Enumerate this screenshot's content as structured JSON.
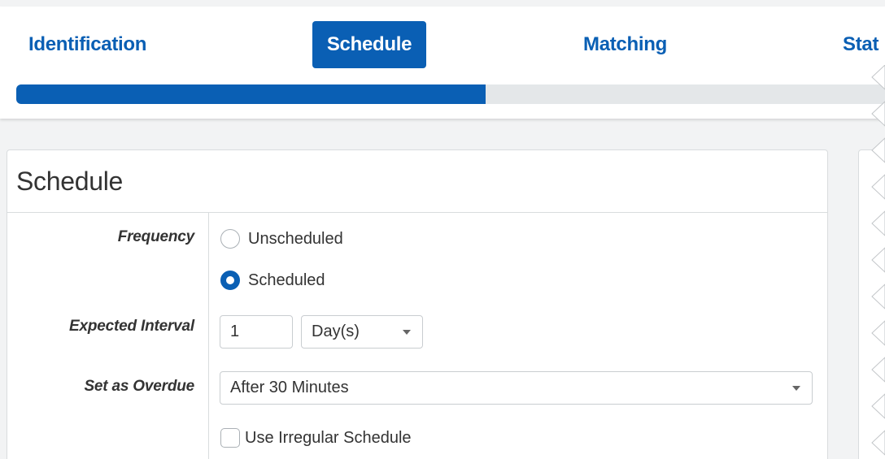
{
  "wizard": {
    "steps": [
      {
        "label": "Identification",
        "active": false
      },
      {
        "label": "Schedule",
        "active": true
      },
      {
        "label": "Matching",
        "active": false
      },
      {
        "label": "Stat",
        "active": false
      }
    ],
    "progress_percent": 54,
    "accent_color": "#0a5fb4"
  },
  "schedule": {
    "title": "Schedule",
    "frequency": {
      "label": "Frequency",
      "options": [
        "Unscheduled",
        "Scheduled"
      ],
      "selected": "Scheduled"
    },
    "expected_interval": {
      "label": "Expected Interval",
      "value": "1",
      "unit": "Day(s)"
    },
    "overdue": {
      "label": "Set as Overdue",
      "value": "After 30 Minutes"
    },
    "irregular": {
      "label": "Use Irregular Schedule",
      "checked": false
    }
  }
}
